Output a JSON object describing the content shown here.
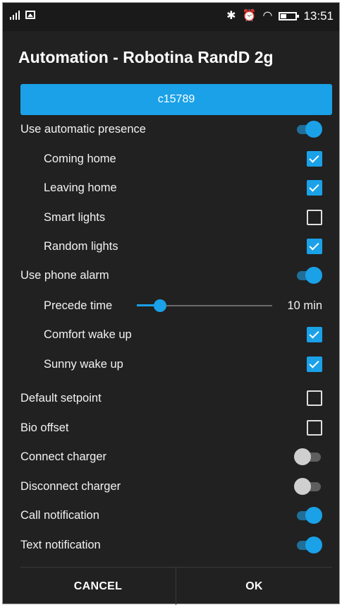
{
  "status_bar": {
    "time": "13:51",
    "icons": [
      "signal-icon",
      "image-notification-icon",
      "bluetooth-icon",
      "alarm-icon",
      "wifi-icon",
      "battery-icon"
    ]
  },
  "dialog": {
    "title": "Automation - Robotina RandD 2g",
    "user_button_label": "c15789",
    "accent_color": "#1aa1e8",
    "rows": [
      {
        "label": "Use automatic presence",
        "control": "switch",
        "on": true
      },
      {
        "label": "Coming home",
        "control": "checkbox",
        "checked": true
      },
      {
        "label": "Leaving home",
        "control": "checkbox",
        "checked": true
      },
      {
        "label": "Smart lights",
        "control": "checkbox",
        "checked": false
      },
      {
        "label": "Random lights",
        "control": "checkbox",
        "checked": true
      },
      {
        "label": "Use phone alarm",
        "control": "switch",
        "on": true
      },
      {
        "label": "Precede time",
        "control": "slider",
        "value_text": "10 min",
        "fraction": 0.17
      },
      {
        "label": "Comfort wake up",
        "control": "checkbox",
        "checked": true
      },
      {
        "label": "Sunny wake up",
        "control": "checkbox",
        "checked": true
      },
      {
        "label": "Default setpoint",
        "control": "checkbox",
        "checked": false
      },
      {
        "label": "Bio offset",
        "control": "checkbox",
        "checked": false
      },
      {
        "label": "Connect charger",
        "control": "switch",
        "on": false
      },
      {
        "label": "Disconnect charger",
        "control": "switch",
        "on": false
      },
      {
        "label": "Call notification",
        "control": "switch",
        "on": true
      },
      {
        "label": "Text notification",
        "control": "switch",
        "on": true
      }
    ],
    "cancel_label": "CANCEL",
    "ok_label": "OK"
  }
}
